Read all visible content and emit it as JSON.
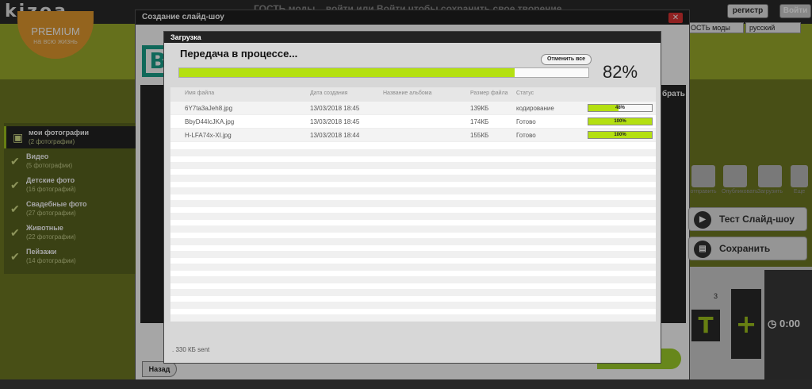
{
  "site": {
    "logo": "kizoa",
    "premium": "PREMIUM",
    "premium_sub": "на всю жизнь",
    "top_message": "ГОСТЬ моды...  войти или Войти чтобы сохранить свое творение",
    "register": "регистр",
    "login": "Войти",
    "mode_select": "ОСТЬ моды",
    "lang_select": "русский"
  },
  "window": {
    "title": "Создание слайд-шоу",
    "close": "✕",
    "collect_label": "брать",
    "back": "Назад"
  },
  "sidebar": {
    "items": [
      {
        "label": "мои фотографии",
        "sub": "(2 фотографии)"
      },
      {
        "label": "Видео",
        "sub": "(5 фотографии)"
      },
      {
        "label": "Детские фото",
        "sub": "(16 фотографий)"
      },
      {
        "label": "Свадебные фото",
        "sub": "(27 фотографии)"
      },
      {
        "label": "Животные",
        "sub": "(22 фотографии)"
      },
      {
        "label": "Пейзажи",
        "sub": "(14 фотографии)"
      }
    ]
  },
  "right": {
    "icons": [
      {
        "label": "отправить",
        "icon": "email-icon"
      },
      {
        "label": "Опубликовать",
        "icon": "facebook-icon"
      },
      {
        "label": "Загрузить",
        "icon": "download-icon"
      },
      {
        "label": "Еще",
        "icon": "more-icon"
      }
    ],
    "test_label": "Тест Слайд-шоу",
    "save_label": "Сохранить",
    "track_number": "3",
    "time": "0:00"
  },
  "dialog": {
    "title": "Загрузка",
    "status": "Передача в процессе...",
    "cancel": "Отменить все",
    "percent_text": "82%",
    "progress": 0.82,
    "columns": [
      "Имя файла",
      "Дата создания",
      "Название альбома",
      "Размер файла",
      "Статус"
    ],
    "rows": [
      {
        "name": "6Y7ta3aJeh8.jpg",
        "date": "13/03/2018 18:45",
        "album": "",
        "size": "139КБ",
        "status": "кодирование",
        "pct_text": "48%",
        "pct": 0.48
      },
      {
        "name": "BbyD44IcJKA.jpg",
        "date": "13/03/2018 18:45",
        "album": "",
        "size": "174КБ",
        "status": "Готово",
        "pct_text": "100%",
        "pct": 1
      },
      {
        "name": "H-LFA74x-XI.jpg",
        "date": "13/03/2018 18:44",
        "album": "",
        "size": "155КБ",
        "status": "Готово",
        "pct_text": "100%",
        "pct": 1
      }
    ],
    "footer": ". 330 КБ sent"
  }
}
